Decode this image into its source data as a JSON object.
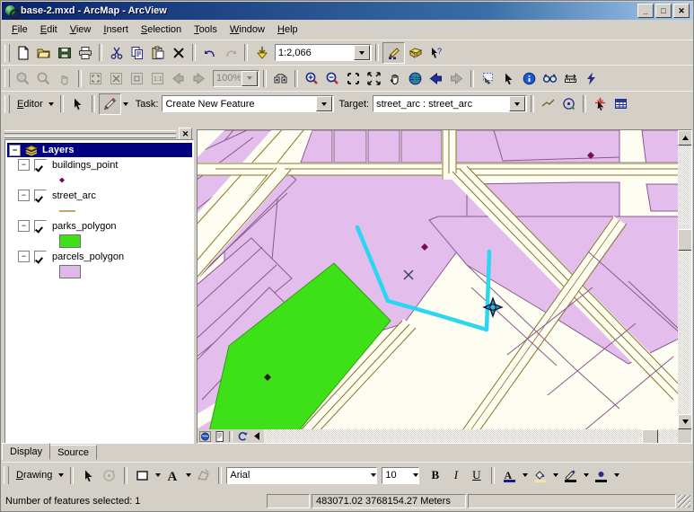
{
  "window": {
    "title": "base-2.mxd - ArcMap - ArcView",
    "minimize": "_",
    "maximize": "□",
    "close": "✕"
  },
  "menu": [
    "File",
    "Edit",
    "View",
    "Insert",
    "Selection",
    "Tools",
    "Window",
    "Help"
  ],
  "standard_toolbar": {
    "scale_value": "1:2,066",
    "buttons": [
      "new-document",
      "open-document",
      "save-document",
      "print",
      "cut",
      "copy",
      "paste",
      "delete",
      "undo",
      "redo",
      "add-data",
      "editor-toolbar-toggle",
      "show-hide-toc",
      "whats-this-help"
    ]
  },
  "layout_toolbar": {
    "zoom_value": "100%",
    "buttons": [
      "zoom-in-layout",
      "zoom-out-layout",
      "pan-layout",
      "fixed-zoom-in",
      "fixed-zoom-out",
      "zoom-whole-page",
      "zoom-100",
      "go-back-extent",
      "go-forward-extent",
      "toggle-draft-mode",
      "zoom-in-map",
      "zoom-out-map",
      "fixed-zoom-in-map",
      "fixed-zoom-out-map",
      "pan-map",
      "full-extent",
      "go-back",
      "go-forward",
      "select-features",
      "select-elements",
      "identify",
      "find",
      "measure",
      "hyperlink"
    ]
  },
  "editor_toolbar": {
    "editor_menu": "Editor",
    "task_label": "Task:",
    "task_value": "Create New Feature",
    "target_label": "Target:",
    "target_value": "street_arc : street_arc"
  },
  "toc": {
    "root": "Layers",
    "layers": [
      {
        "name": "buildings_point",
        "checked": true,
        "symbol": "point",
        "color": "#800060"
      },
      {
        "name": "street_arc",
        "checked": true,
        "symbol": "line",
        "color": "#c8a860"
      },
      {
        "name": "parks_polygon",
        "checked": true,
        "symbol": "polygon",
        "color": "#3ee018"
      },
      {
        "name": "parcels_polygon",
        "checked": true,
        "symbol": "polygon",
        "color": "#e0b8ea"
      }
    ],
    "tabs": [
      {
        "label": "Display",
        "active": true
      },
      {
        "label": "Source",
        "active": false
      }
    ]
  },
  "map": {
    "parcel_fill": "#e3bdec",
    "parcel_outline": "#8a5a8a",
    "street_fill": "#fdfdf2",
    "street_outline": "#8a7420",
    "park_fill": "#3ee018",
    "building_point_color": "#7b0a5e",
    "sketch_color": "#2ad6f0",
    "view_buttons": [
      "data-view",
      "layout-view",
      "refresh-view",
      "pause-drawing"
    ]
  },
  "drawing_toolbar": {
    "menu_label": "Drawing",
    "font_name": "Arial",
    "font_size": "10",
    "bold": "B",
    "italic": "I",
    "underline": "U",
    "buttons": [
      "select-elements",
      "rotate-element",
      "new-rectangle",
      "fill-color",
      "font-color",
      "nudge",
      "bold",
      "italic",
      "underline",
      "text-color",
      "fill-color-swatch",
      "line-color",
      "marker-color"
    ]
  },
  "status_bar": {
    "message": "Number of features selected: 1",
    "coordinates": "483071.02  3768154.27 Meters"
  }
}
